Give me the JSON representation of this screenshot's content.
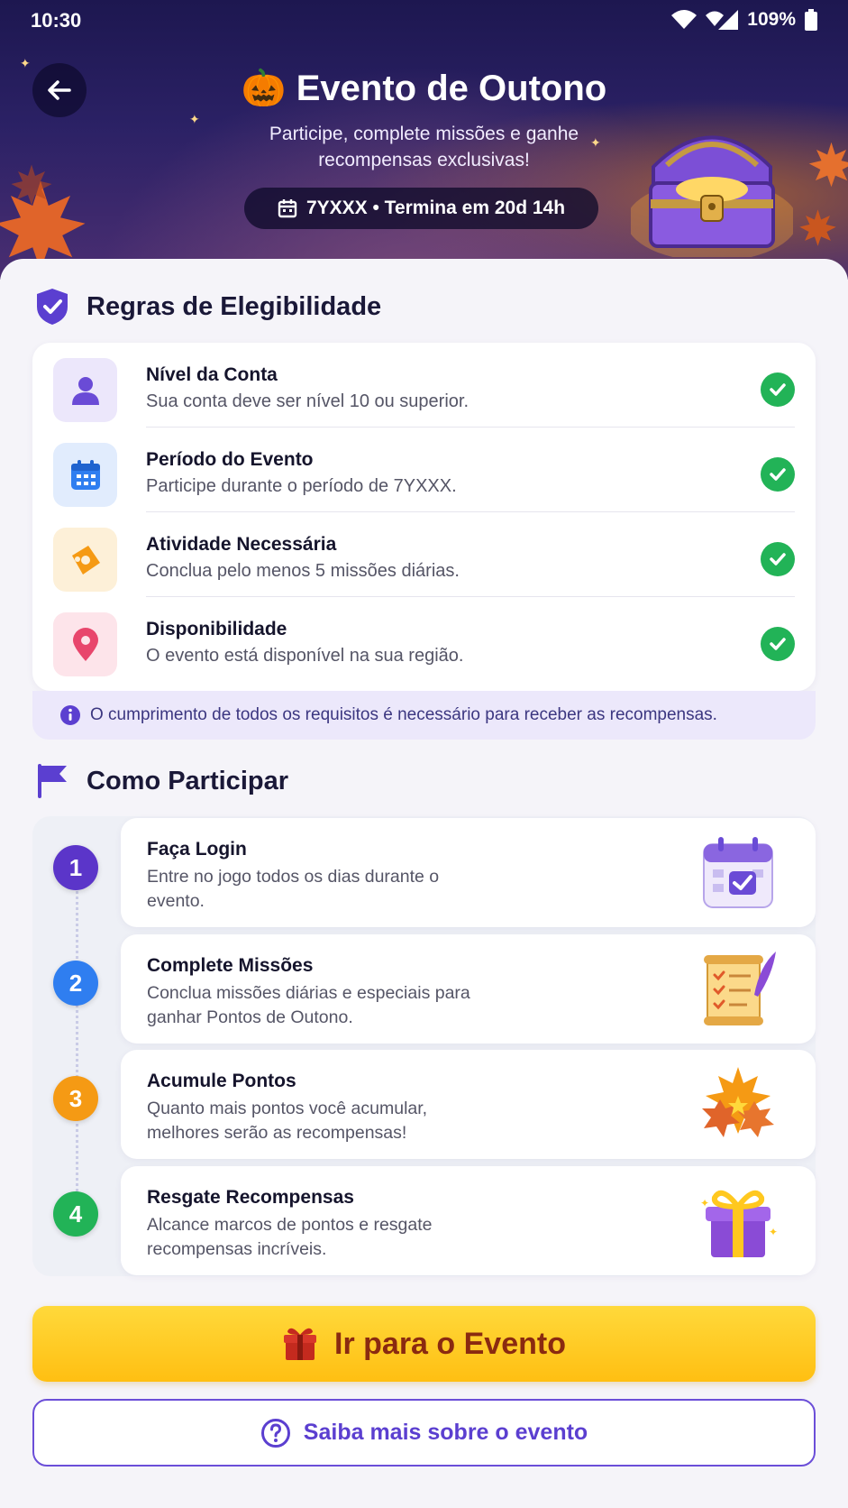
{
  "status_bar": {
    "time": "10:30",
    "battery": "109%"
  },
  "header": {
    "emoji": "🎃",
    "title": "Evento de Outono",
    "subtitle": "Participe, complete missões e ganhe recompensas exclusivas!",
    "date_pill": "7YXXX • Termina em 20d 14h"
  },
  "eligibility": {
    "title": "Regras de Elegibilidade",
    "rules": [
      {
        "title": "Nível da Conta",
        "desc": "Sua conta deve ser nível 10 ou superior.",
        "icon": "user-icon",
        "met": true
      },
      {
        "title": "Período do Evento",
        "desc": "Participe durante o período de 7YXXX.",
        "icon": "calendar-icon",
        "met": true
      },
      {
        "title": "Atividade Necessária",
        "desc": "Conclua pelo menos 5 missões diárias.",
        "icon": "ticket-icon",
        "met": true
      },
      {
        "title": "Disponibilidade",
        "desc": "O evento está disponível na sua região.",
        "icon": "location-pin-icon",
        "met": true
      }
    ],
    "notice": "O cumprimento de todos os requisitos é necessário para receber as recompensas."
  },
  "participate": {
    "title": "Como Participar",
    "steps": [
      {
        "num": "1",
        "title": "Faça Login",
        "desc": "Entre no jogo todos os dias durante o evento.",
        "color": "#5b35c9",
        "art": "calendar-check-icon"
      },
      {
        "num": "2",
        "title": "Complete Missões",
        "desc": "Conclua missões diárias e especiais para ganhar Pontos de Outono.",
        "color": "#2f7ef0",
        "art": "scroll-quill-icon"
      },
      {
        "num": "3",
        "title": "Acumule Pontos",
        "desc": "Quanto mais pontos você acumular, melhores serão as recompensas!",
        "color": "#f59a14",
        "art": "autumn-leaves-icon"
      },
      {
        "num": "4",
        "title": "Resgate Recompensas",
        "desc": "Alcance marcos de pontos e resgate recompensas incríveis.",
        "color": "#22b357",
        "art": "gift-box-icon"
      }
    ]
  },
  "actions": {
    "primary": "Ir para o Evento",
    "secondary": "Saiba mais sobre o evento"
  },
  "colors": {
    "accent": "#5b3fd0",
    "cta": "#ffc81f",
    "success": "#22b357"
  }
}
